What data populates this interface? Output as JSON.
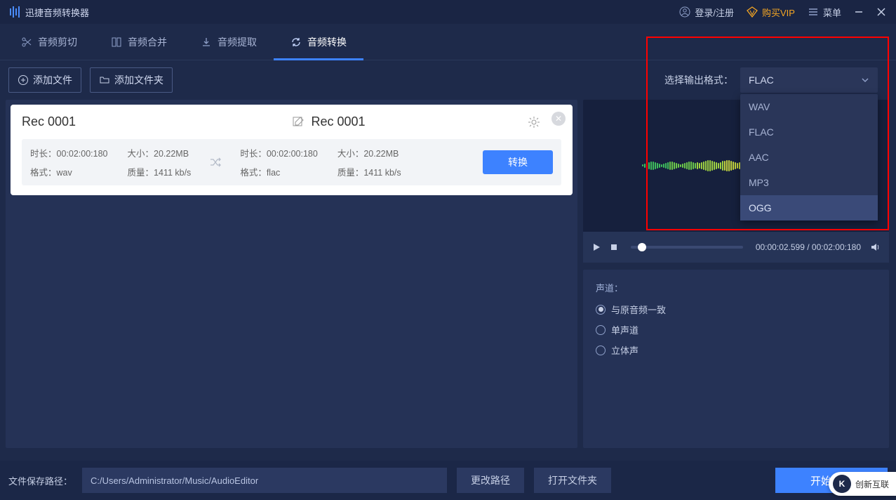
{
  "app": {
    "title": "迅捷音频转换器"
  },
  "title_actions": {
    "login": "登录/注册",
    "buy_vip": "购买VIP",
    "menu": "菜单"
  },
  "tabs": [
    {
      "id": "cut",
      "label": "音频剪切"
    },
    {
      "id": "merge",
      "label": "音频合并"
    },
    {
      "id": "extract",
      "label": "音频提取"
    },
    {
      "id": "convert",
      "label": "音频转换",
      "active": true
    }
  ],
  "toolbar": {
    "add_file": "添加文件",
    "add_folder": "添加文件夹",
    "output_format_label": "选择输出格式：",
    "selected_format": "FLAC",
    "format_options": [
      "WAV",
      "FLAC",
      "AAC",
      "MP3",
      "OGG"
    ],
    "hover_option": "OGG"
  },
  "card": {
    "source_name": "Rec 0001",
    "target_name": "Rec 0001",
    "src": {
      "duration_label": "时长：",
      "duration": "00:02:00:180",
      "size_label": "大小：",
      "size": "20.22MB",
      "format_label": "格式：",
      "format": "wav",
      "quality_label": "质量：",
      "quality": "1411 kb/s"
    },
    "dst": {
      "duration_label": "时长：",
      "duration": "00:02:00:180",
      "size_label": "大小：",
      "size": "20.22MB",
      "format_label": "格式：",
      "format": "flac",
      "quality_label": "质量：",
      "quality": "1411 kb/s"
    },
    "convert_button": "转换"
  },
  "player": {
    "current_time": "00:00:02.599",
    "total_time": "00:02:00:180",
    "sep": " / "
  },
  "channel": {
    "title": "声道：",
    "options": [
      {
        "label": "与原音频一致",
        "selected": true
      },
      {
        "label": "单声道",
        "selected": false
      },
      {
        "label": "立体声",
        "selected": false
      }
    ]
  },
  "footer": {
    "path_label": "文件保存路径：",
    "path_value": "C:/Users/Administrator/Music/AudioEditor",
    "change_path": "更改路径",
    "open_folder": "打开文件夹",
    "start": "开始转换"
  },
  "watermark": {
    "text": "创新互联"
  }
}
